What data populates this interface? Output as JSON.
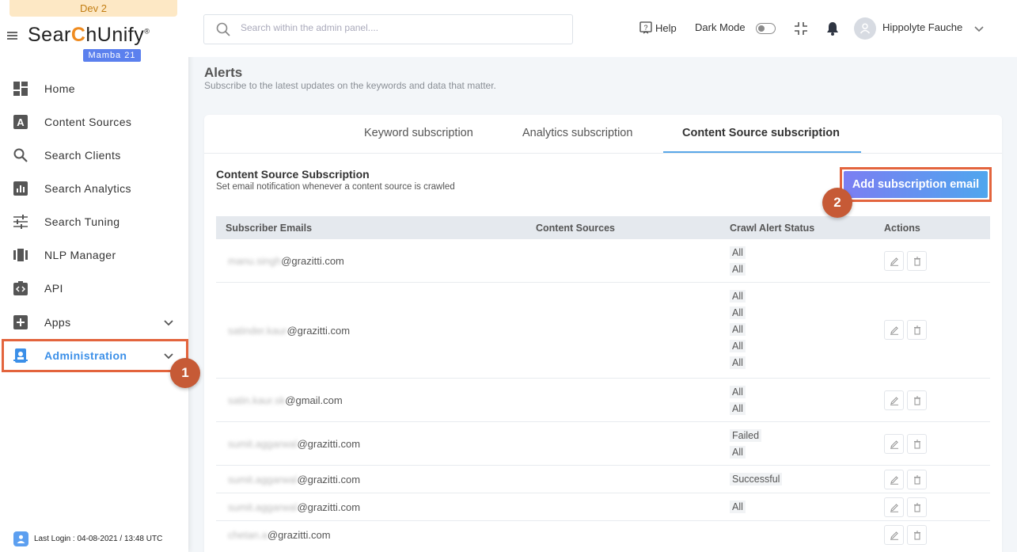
{
  "env_badge": "Dev 2",
  "brand": {
    "logo_pre": "Sear",
    "logo_c": "C",
    "logo_post": "hUnify",
    "logo_reg": "®",
    "version": "Mamba 21"
  },
  "sidebar": {
    "items": [
      {
        "label": "Home",
        "icon": "dashboard-icon"
      },
      {
        "label": "Content Sources",
        "icon": "letter-a-icon"
      },
      {
        "label": "Search Clients",
        "icon": "search-icon"
      },
      {
        "label": "Search Analytics",
        "icon": "bar-chart-icon"
      },
      {
        "label": "Search Tuning",
        "icon": "sliders-icon"
      },
      {
        "label": "NLP Manager",
        "icon": "nlp-icon"
      },
      {
        "label": "API",
        "icon": "api-icon"
      },
      {
        "label": "Apps",
        "icon": "plus-square-icon"
      },
      {
        "label": "Administration",
        "icon": "admin-icon"
      }
    ],
    "last_login": "Last Login : 04-08-2021 / 13:48 UTC"
  },
  "topbar": {
    "search_placeholder": "Search within the admin panel....",
    "help": "Help",
    "dark_mode": "Dark Mode",
    "user_name": "Hippolyte Fauche"
  },
  "page": {
    "title": "Alerts",
    "subtitle": "Subscribe to the latest updates on the keywords and data that matter."
  },
  "tabs": [
    "Keyword subscription",
    "Analytics subscription",
    "Content Source subscription"
  ],
  "section": {
    "title": "Content Source Subscription",
    "subtitle": "Set email notification whenever a content source is crawled",
    "add_button": "Add subscription email"
  },
  "steps": [
    "1",
    "2"
  ],
  "table": {
    "headers": [
      "Subscriber Emails",
      "Content Sources",
      "Crawl Alert Status",
      "Actions"
    ],
    "rows": [
      {
        "email_hidden": "manu.singh",
        "email_domain": "@grazitti.com",
        "statuses": [
          "All",
          "All"
        ]
      },
      {
        "email_hidden": "satinder.kaur",
        "email_domain": "@grazitti.com",
        "statuses": [
          "All",
          "All",
          "All",
          "All",
          "All"
        ]
      },
      {
        "email_hidden": "satin.kaur.sk",
        "email_domain": "@gmail.com",
        "statuses": [
          "All",
          "All"
        ]
      },
      {
        "email_hidden": "sumit.aggarwal",
        "email_domain": "@grazitti.com",
        "statuses": [
          "Failed",
          "All"
        ]
      },
      {
        "email_hidden": "sumit.aggarwal",
        "email_domain": "@grazitti.com",
        "statuses": [
          "Successful"
        ]
      },
      {
        "email_hidden": "sumit.aggarwal",
        "email_domain": "@grazitti.com",
        "statuses": [
          "All"
        ]
      },
      {
        "email_hidden": "chetan.a",
        "email_domain": "@grazitti.com",
        "statuses": []
      }
    ]
  },
  "colors": {
    "accent": "#3b8fe8",
    "highlight": "#e3643d",
    "step_circle": "#c65a36"
  }
}
